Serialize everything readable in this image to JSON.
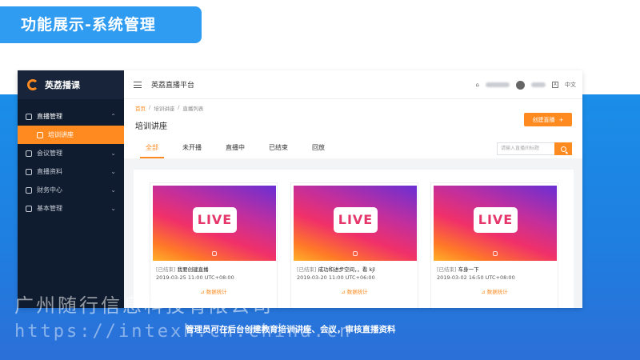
{
  "banner": {
    "title": "功能展示-系统管理"
  },
  "brand": {
    "name": "英荔播课"
  },
  "sidebar": {
    "items": [
      {
        "label": "直播管理"
      },
      {
        "label": "培训讲座"
      },
      {
        "label": "会议管理"
      },
      {
        "label": "直播资料"
      },
      {
        "label": "财务中心"
      },
      {
        "label": "基本管理"
      }
    ]
  },
  "topbar": {
    "title": "英荔直播平台",
    "lang": "中文"
  },
  "breadcrumb": [
    "首页",
    "培训讲座",
    "直播列表"
  ],
  "page": {
    "title": "培训讲座",
    "create_label": "创建直播"
  },
  "tabs": [
    "全部",
    "未开播",
    "直播中",
    "已结束",
    "回放"
  ],
  "search": {
    "placeholder": "请输入直播间标题"
  },
  "cards": [
    {
      "badge": "LIVE",
      "status": "[已结束]",
      "title": "我要创建直播",
      "time": "2019-03-25 11:00 UTC+08:00",
      "stats": "数据统计"
    },
    {
      "badge": "LIVE",
      "status": "[已结束]",
      "title": "成功和进步空间，，看 kjl",
      "time": "2019-03-20 11:00 UTC+06:00",
      "stats": "数据统计"
    },
    {
      "badge": "LIVE",
      "status": "[已结束]",
      "title": "车身一下",
      "time": "2019-03-02 16:50 UTC+08:00",
      "stats": "数据统计"
    }
  ],
  "watermark": {
    "company": "广州随行信息科技有限公司",
    "url": "https://intexh.cn.china.cn"
  },
  "caption": "管理员可在后台创建教育培训讲座、会议，审核直播资料",
  "colors": {
    "accent": "#ff8a1f",
    "sidebar": "#0f1b2e",
    "banner": "#2f9cf2",
    "background": "#1f7fe0"
  }
}
